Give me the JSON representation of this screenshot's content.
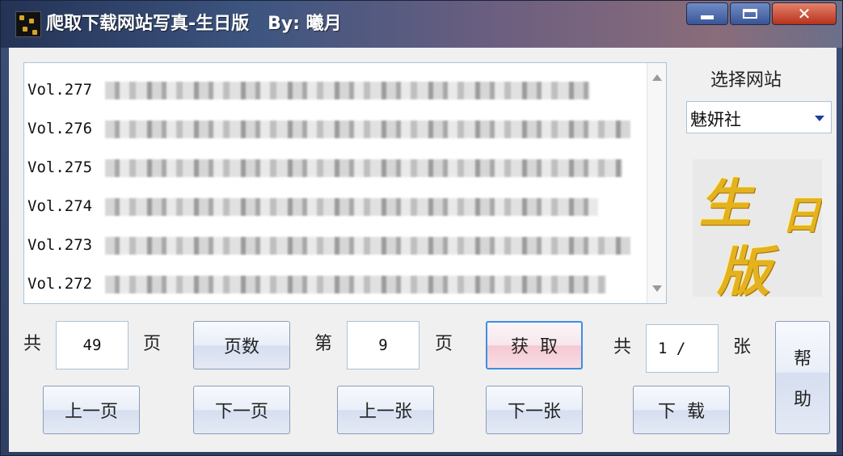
{
  "window": {
    "title": "爬取下载网站写真-生日版   By: 曦月"
  },
  "list": {
    "items": [
      {
        "label": "Vol.277"
      },
      {
        "label": "Vol.276"
      },
      {
        "label": "Vol.275"
      },
      {
        "label": "Vol.274"
      },
      {
        "label": "Vol.273"
      },
      {
        "label": "Vol.272"
      }
    ]
  },
  "site": {
    "label": "选择网站",
    "selected": "魅妍社"
  },
  "image": {
    "chars": [
      "生",
      "日",
      "版"
    ]
  },
  "controls": {
    "total_prefix": "共",
    "total_pages": "49",
    "page_suffix": "页",
    "page_count_button": "页数",
    "current_prefix": "第",
    "current_page": "9",
    "current_suffix": "页",
    "fetch_button": "获  取",
    "images_prefix": "共",
    "images_value": "1 /",
    "images_suffix": "张",
    "help_char1": "帮",
    "help_char2": "助",
    "prev_page_button": "上一页",
    "next_page_button": "下一页",
    "prev_image_button": "上一张",
    "next_image_button": "下一张",
    "download_button": "下  载"
  },
  "colors": {
    "accent": "#3d8ee5",
    "title_text": "#ffffff",
    "gold": "#e3b21e",
    "close_button": "#b8321c"
  },
  "icons": [
    "app-icon",
    "minimize-icon",
    "maximize-icon",
    "close-icon",
    "scroll-up-arrow",
    "scroll-down-arrow",
    "dropdown-arrow"
  ]
}
